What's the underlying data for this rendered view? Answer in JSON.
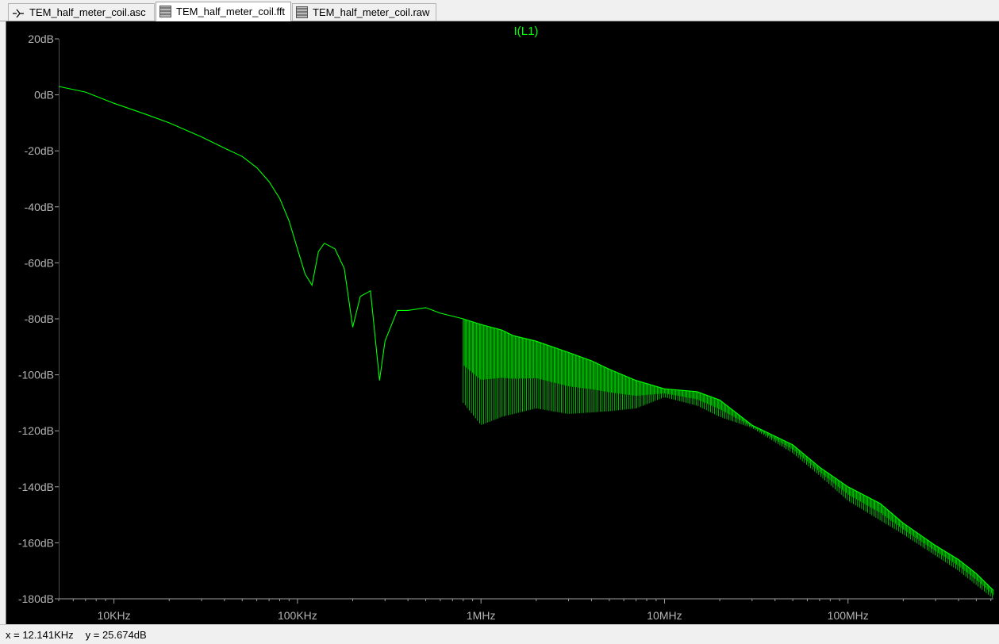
{
  "tabs": [
    {
      "label": "TEM_half_meter_coil.asc",
      "icon": "schematic-icon",
      "active": false
    },
    {
      "label": "TEM_half_meter_coil.fft",
      "icon": "waveform-icon",
      "active": true
    },
    {
      "label": "TEM_half_meter_coil.raw",
      "icon": "waveform-icon",
      "active": false
    }
  ],
  "status": {
    "x_readout": "x = 12.141KHz",
    "y_readout": "y = 25.674dB"
  },
  "chart_data": {
    "type": "line",
    "title": "",
    "xlabel": "",
    "ylabel": "",
    "x_scale": "log",
    "xlim": [
      5000,
      620000000
    ],
    "ylim": [
      -180,
      20
    ],
    "x_ticks": [
      {
        "label": "10KHz",
        "value": 10000
      },
      {
        "label": "100KHz",
        "value": 100000
      },
      {
        "label": "1MHz",
        "value": 1000000
      },
      {
        "label": "10MHz",
        "value": 10000000
      },
      {
        "label": "100MHz",
        "value": 100000000
      }
    ],
    "y_ticks": [
      {
        "label": "20dB",
        "value": 20
      },
      {
        "label": "0dB",
        "value": 0
      },
      {
        "label": "-20dB",
        "value": -20
      },
      {
        "label": "-40dB",
        "value": -40
      },
      {
        "label": "-60dB",
        "value": -60
      },
      {
        "label": "-80dB",
        "value": -80
      },
      {
        "label": "-100dB",
        "value": -100
      },
      {
        "label": "-120dB",
        "value": -120
      },
      {
        "label": "-140dB",
        "value": -140
      },
      {
        "label": "-160dB",
        "value": -160
      },
      {
        "label": "-180dB",
        "value": -180
      }
    ],
    "grid": false,
    "background": "#000000",
    "axis_color": "#a0a0a0",
    "tick_label_color": "#000000",
    "series": [
      {
        "name": "I(L1)",
        "color": "#00ff00",
        "x": [
          5000,
          7000,
          10000,
          15000,
          20000,
          30000,
          40000,
          50000,
          60000,
          70000,
          80000,
          90000,
          100000,
          110000,
          120000,
          130000,
          140000,
          160000,
          180000,
          200000,
          220000,
          250000,
          280000,
          300000,
          350000,
          400000,
          500000,
          600000,
          800000,
          1000000,
          1300000,
          1500000,
          2000000,
          3000000,
          4000000,
          5000000,
          7000000,
          10000000,
          15000000,
          20000000,
          30000000,
          50000000,
          70000000,
          100000000,
          150000000,
          200000000,
          300000000,
          400000000,
          500000000,
          620000000
        ],
        "y": [
          3,
          1,
          -3,
          -7,
          -10,
          -15,
          -19,
          -22,
          -26,
          -31,
          -37,
          -45,
          -55,
          -64,
          -68,
          -56,
          -53,
          -55,
          -62,
          -83,
          -72,
          -70,
          -102,
          -88,
          -77,
          -77,
          -76,
          -78,
          -80,
          -82,
          -84,
          -86,
          -88,
          -92,
          -95,
          -98,
          -102,
          -105,
          -106,
          -109,
          -118,
          -125,
          -133,
          -140,
          -146,
          -153,
          -161,
          -166,
          -171,
          -177
        ],
        "envelope_low": [
          [
            800000,
            -110
          ],
          [
            1000000,
            -118
          ],
          [
            1300000,
            -115
          ],
          [
            2000000,
            -112
          ],
          [
            3000000,
            -114
          ],
          [
            5000000,
            -113
          ],
          [
            7000000,
            -112
          ],
          [
            10000000,
            -108
          ],
          [
            15000000,
            -111
          ],
          [
            20000000,
            -115
          ],
          [
            30000000,
            -119
          ],
          [
            50000000,
            -128
          ],
          [
            70000000,
            -136
          ],
          [
            100000000,
            -145
          ],
          [
            200000000,
            -157
          ],
          [
            400000000,
            -170
          ],
          [
            620000000,
            -180
          ]
        ]
      }
    ]
  }
}
